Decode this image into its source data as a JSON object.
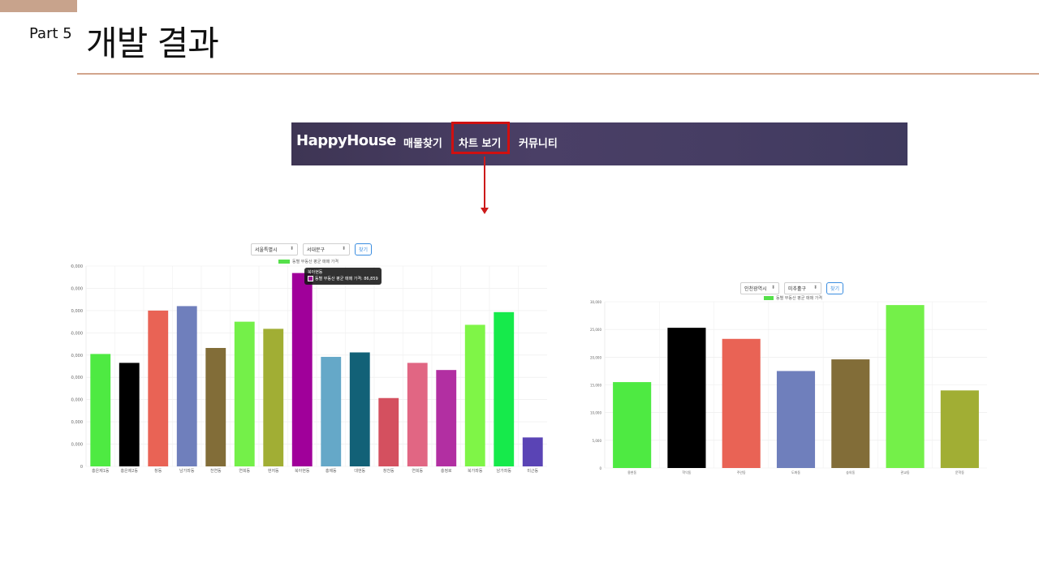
{
  "slide": {
    "part_label": "Part 5",
    "title": "개발 결과",
    "accent_color": "#c8a38c",
    "rule_color": "#d2a58c"
  },
  "navbar": {
    "brand": "HappyHouse",
    "items": [
      {
        "label": "매물찾기"
      },
      {
        "label": "차트 보기"
      },
      {
        "label": "커뮤니티"
      }
    ],
    "highlight_color": "#d01010"
  },
  "left_chart": {
    "city_select": "서울특별시",
    "district_select": "서대문구",
    "search_label": "찾기",
    "legend_label": "동별 부동산 평균 매매 가격",
    "tooltip_title": "북아현동",
    "tooltip_body": "동별 부동산 평균 매매 가격: 86,859"
  },
  "right_chart": {
    "city_select": "인천광역시",
    "district_select": "미추홀구",
    "search_label": "찾기",
    "legend_label": "동별 부동산 평균 매매 가격"
  },
  "chart_data": [
    {
      "type": "bar",
      "title": "",
      "series_label": "동별 부동산 평균 매매 가격",
      "categories": [
        "홍은제1동",
        "홍은제2동",
        "창동",
        "남가좌동",
        "천연동",
        "연희동",
        "현저동",
        "북아현동",
        "홍제동",
        "대현동",
        "창천동",
        "연희동",
        "충정로",
        "북가좌동",
        "남가좌동",
        "미근동"
      ],
      "values": [
        50500,
        46500,
        70000,
        72000,
        53200,
        65000,
        61800,
        86859,
        49200,
        51200,
        30700,
        46500,
        43300,
        63600,
        69300,
        13000
      ],
      "colors": [
        "#4eea42",
        "#000000",
        "#e96355",
        "#6f7fbc",
        "#826d38",
        "#74f049",
        "#a1ae34",
        "#a0009a",
        "#65a8c8",
        "#126177",
        "#d4505f",
        "#e16683",
        "#b22fa2",
        "#7ff547",
        "#16ea4b",
        "#5a44b5"
      ],
      "ylim": [
        0,
        90000
      ],
      "yticks": [
        "0",
        "10,000",
        "20,000",
        "30,000",
        "40,000",
        "50,000",
        "60,000",
        "70,000",
        "80,000",
        "90,000"
      ],
      "grid": true
    },
    {
      "type": "bar",
      "title": "",
      "series_label": "동별 부동산 평균 매매 가격",
      "categories": [
        "용현동",
        "학익동",
        "주안동",
        "도화동",
        "숭의동",
        "관교동",
        "문학동"
      ],
      "values": [
        15500,
        25300,
        23300,
        17500,
        19600,
        29400,
        14000
      ],
      "colors": [
        "#4eea42",
        "#000000",
        "#e96355",
        "#6f7fbc",
        "#826d38",
        "#74f049",
        "#a1ae34"
      ],
      "ylim": [
        0,
        30000
      ],
      "yticks": [
        "0",
        "5,000",
        "10,000",
        "15,000",
        "20,000",
        "25,000",
        "30,000"
      ],
      "grid": true
    }
  ]
}
